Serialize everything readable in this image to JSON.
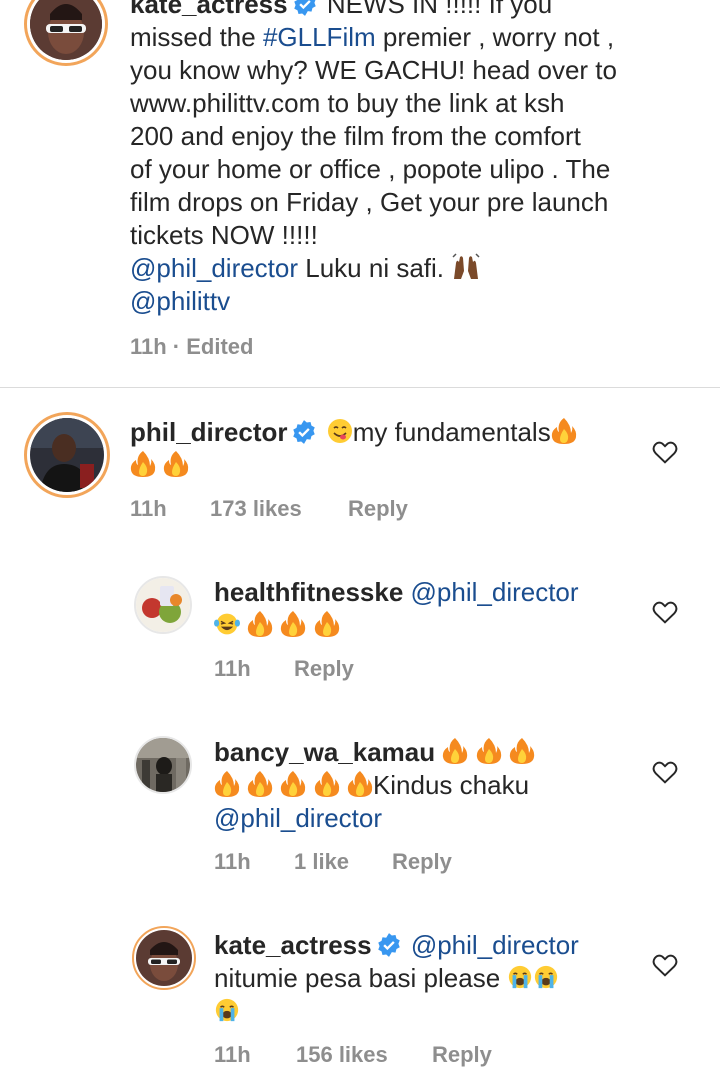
{
  "caption": {
    "username": "kate_actress",
    "line1_rest": "NEWS IN !!!!! If you",
    "line2_a": "missed the ",
    "line2_hashtag": "#GLLFilm",
    "line2_b": "  premier , worry not ,",
    "line3": "you know why? WE GACHU!  head over to",
    "line4": "www.philittv.com to buy  the link at ksh",
    "line5": "200  and enjoy the film  from the comfort",
    "line6": "of your home or office , popote  ulipo . The",
    "line7": "film drops on Friday , Get your pre launch",
    "line8": "tickets NOW !!!!!",
    "line9_mention": "@phil_director",
    "line9_text": " Luku ni safi. ",
    "line10_mention": "@philittv",
    "meta": "11h · Edited"
  },
  "comments": [
    {
      "username": "phil_director",
      "text": "my fundamentals",
      "time": "11h",
      "likes": "173 likes",
      "reply": "Reply"
    },
    {
      "username": "healthfitnesske",
      "mention": "@phil_director",
      "time": "11h",
      "reply": "Reply"
    },
    {
      "username": "bancy_wa_kamau",
      "text": "Kindus chaku",
      "mention": "@phil_director",
      "time": "11h",
      "likes": "1 like",
      "reply": "Reply"
    },
    {
      "username": "kate_actress",
      "mention": "@phil_director",
      "text": "nitumie pesa basi  please ",
      "time": "11h",
      "likes": "156 likes",
      "reply": "Reply"
    }
  ],
  "colors": {
    "mention": "#1a4d8f",
    "meta": "#8e8e8e",
    "verified": "#3897f0",
    "story_ring": "#f2a55a"
  },
  "icons": [
    "verified-badge-icon",
    "heart-icon",
    "fire-emoji-icon",
    "laugh-cry-emoji-icon",
    "loudly-crying-emoji-icon",
    "yum-emoji-icon",
    "raised-hands-emoji-icon"
  ]
}
